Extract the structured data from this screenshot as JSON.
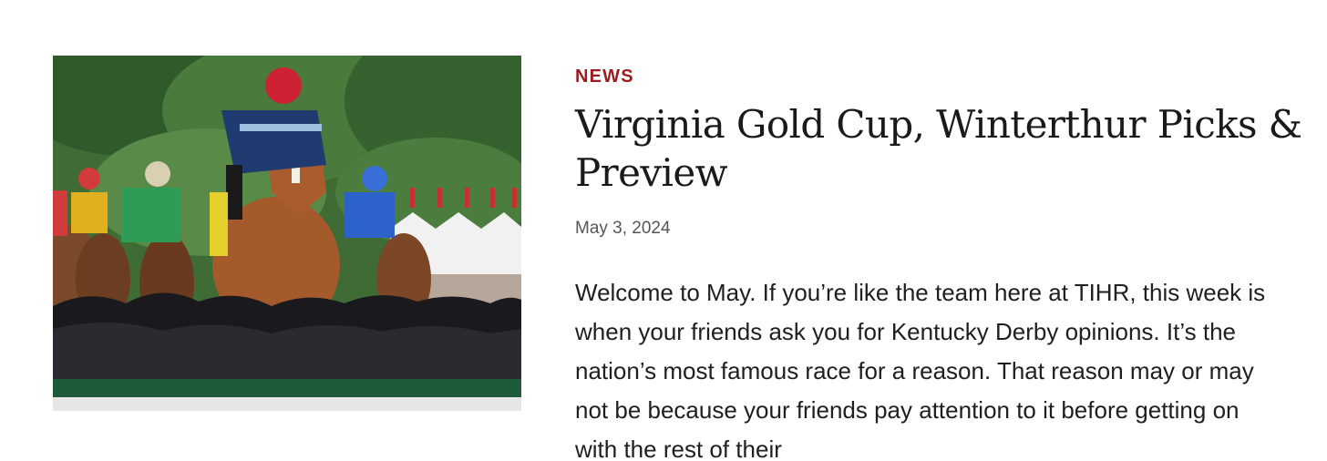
{
  "article": {
    "category": "NEWS",
    "title": "Virginia Gold Cup, Winterthur Picks & Preview",
    "date": "May 3, 2024",
    "excerpt": "Welcome to May. If you’re like the team here at TIHR, this week is when your friends ask you for Kentucky Derby opinions. It’s the nation’s most famous race for a reason. That reason may or may not be because your friends pay attention to it before getting on with the rest of their"
  },
  "colors": {
    "category": "#9b1b1e",
    "title": "#1a1a1a",
    "date": "#555555",
    "body": "#1f1f1f"
  }
}
